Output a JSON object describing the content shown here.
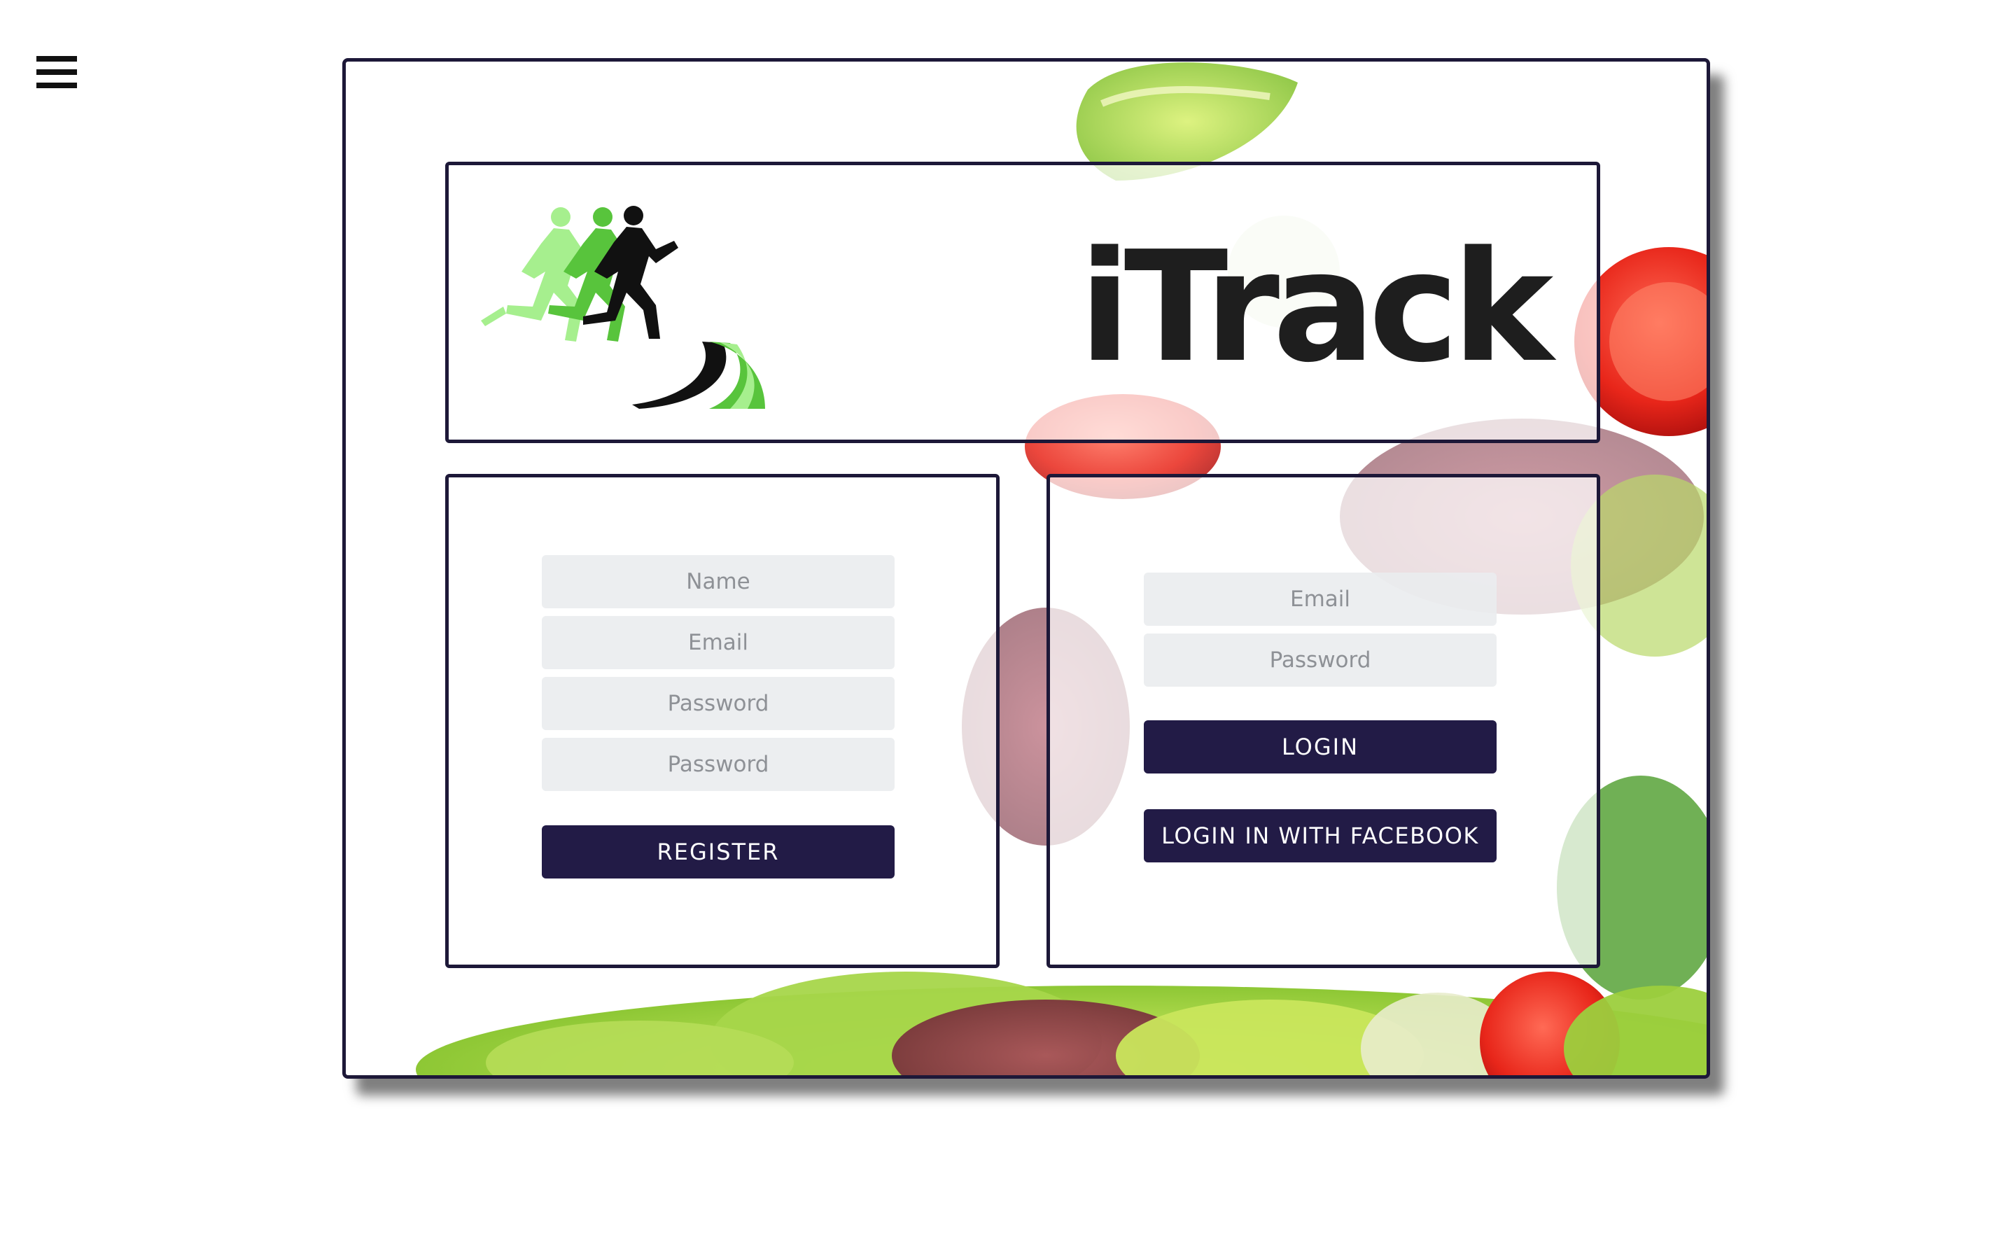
{
  "nav": {
    "menu_icon": "hamburger-menu-icon"
  },
  "header": {
    "brand_title": "iTrack",
    "logo_icon": "running-figures-logo",
    "colors": {
      "runner_light": "#a6ef8e",
      "runner_mid": "#58c43c",
      "runner_dark": "#111111"
    }
  },
  "register": {
    "name_placeholder": "Name",
    "email_placeholder": "Email",
    "password_placeholder": "Password",
    "confirm_password_placeholder": "Password",
    "button_label": "REGISTER"
  },
  "login": {
    "email_placeholder": "Email",
    "password_placeholder": "Password",
    "button_label": "LOGIN",
    "facebook_button_label": "LOGIN IN WITH FACEBOOK"
  },
  "theme": {
    "accent": "#221b46",
    "border": "#1d1838",
    "field_bg": "#eaecee"
  }
}
